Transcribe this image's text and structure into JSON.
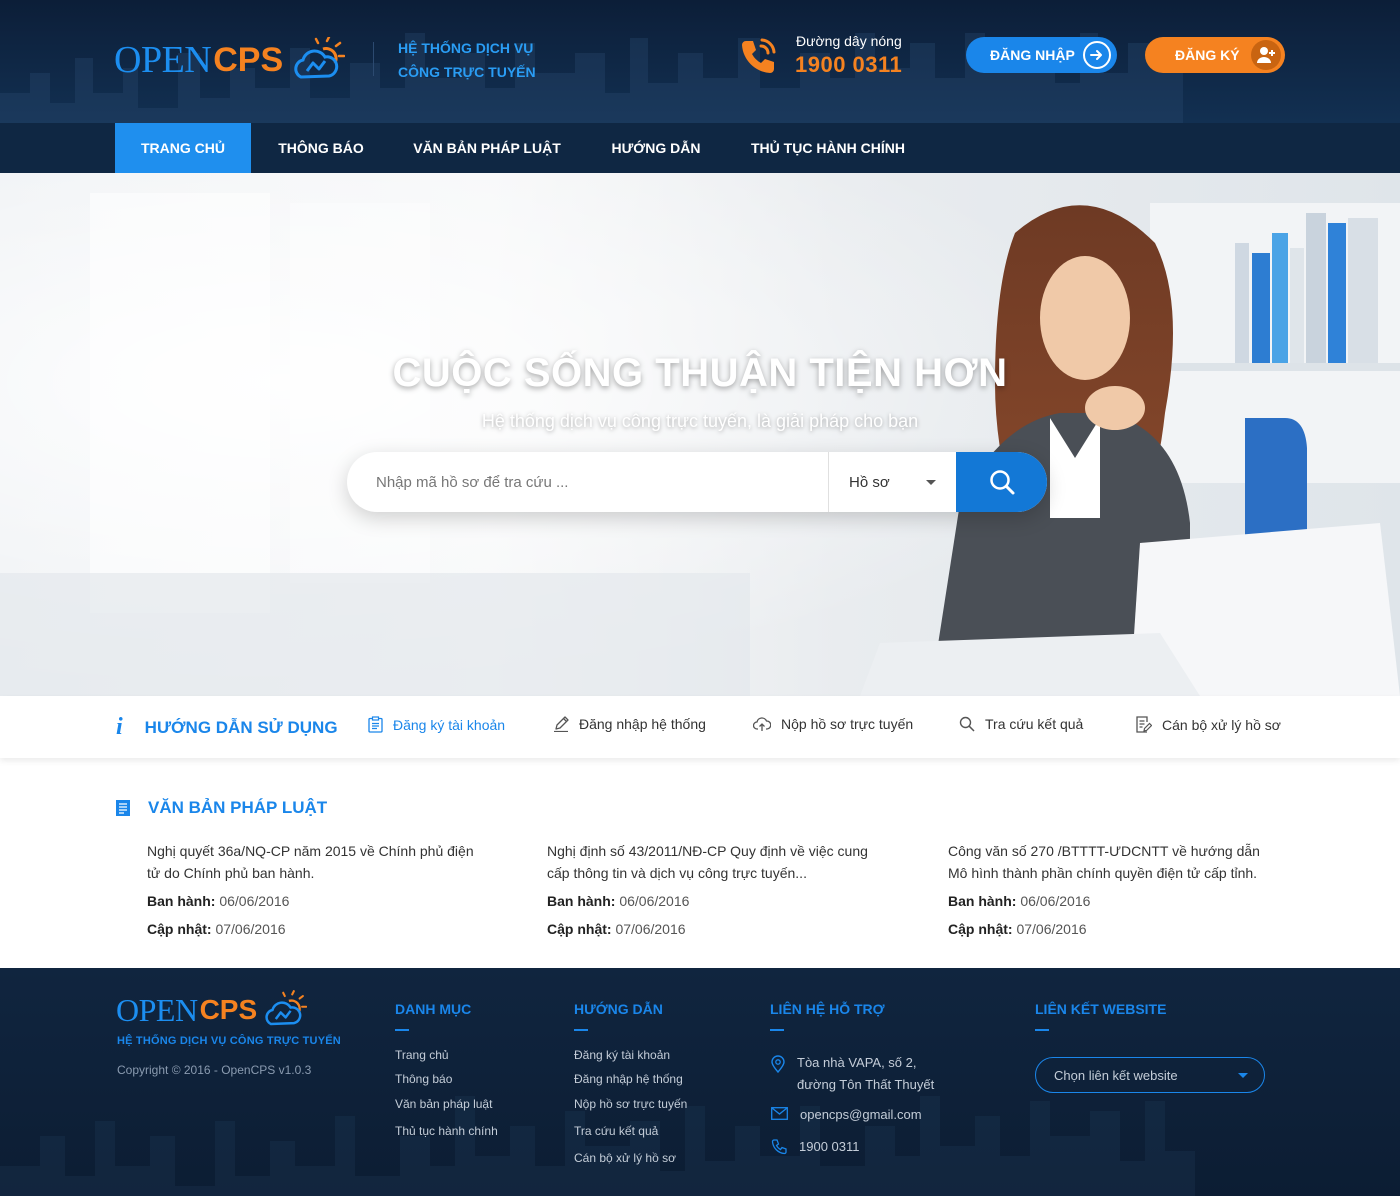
{
  "header": {
    "logo_open": "OPEN",
    "logo_cps": "CPS",
    "tagline_line1": "HỆ THỐNG DỊCH VỤ",
    "tagline_line2": "CÔNG TRỰC TUYẾN",
    "hotline_label": "Đường dây nóng",
    "hotline_number": "1900 0311",
    "login_label": "ĐĂNG NHẬP",
    "register_label": "ĐĂNG KÝ"
  },
  "nav": {
    "items": [
      {
        "label": "TRANG CHỦ",
        "active": true
      },
      {
        "label": "THÔNG BÁO",
        "active": false
      },
      {
        "label": "VĂN BẢN PHÁP LUẬT",
        "active": false
      },
      {
        "label": "HƯỚNG DẪN",
        "active": false
      },
      {
        "label": "THỦ TỤC HÀNH CHÍNH",
        "active": false
      }
    ]
  },
  "hero": {
    "title": "CUỘC SỐNG THUẬN TIỆN HƠN",
    "subtitle": "Hệ thống dịch vụ công trực tuyến, là giải pháp cho bạn",
    "search_placeholder": "Nhập mã hồ sơ để tra cứu ...",
    "search_type_selected": "Hồ sơ"
  },
  "guide": {
    "title": "HƯỚNG DẪN SỬ DỤNG",
    "items": [
      {
        "label": "Đăng ký tài khoản",
        "icon": "clipboard-icon"
      },
      {
        "label": "Đăng nhập hệ thống",
        "icon": "pencil-icon"
      },
      {
        "label": "Nộp hồ sơ trực tuyến",
        "icon": "cloud-upload-icon"
      },
      {
        "label": "Tra cứu kết quả",
        "icon": "search-icon"
      },
      {
        "label": "Cán bộ xử lý hồ sơ",
        "icon": "document-edit-icon"
      }
    ]
  },
  "docs": {
    "title": "VĂN BẢN PHÁP LUẬT",
    "issued_label": "Ban hành:",
    "updated_label": "Cập nhật:",
    "items": [
      {
        "title": "Nghị quyết 36a/NQ-CP năm 2015 về Chính phủ điện tử do Chính phủ ban hành.",
        "issued": "06/06/2016",
        "updated": "07/06/2016"
      },
      {
        "title": "Nghị định số 43/2011/NĐ-CP Quy định về việc cung cấp thông tin và dịch vụ công trực tuyến...",
        "issued": "06/06/2016",
        "updated": "07/06/2016"
      },
      {
        "title": "Công văn số 270 /BTTTT-ƯDCNTT về hướng dẫn Mô hình thành phần chính quyền điện tử cấp tỉnh.",
        "issued": "06/06/2016",
        "updated": "07/06/2016"
      }
    ]
  },
  "footer": {
    "tagline": "HỆ THỐNG DỊCH VỤ CÔNG TRỰC TUYẾN",
    "copyright": "Copyright © 2016 - OpenCPS v1.0.3",
    "danh_muc": {
      "title": "DANH MỤC",
      "links": [
        "Trang chủ",
        "Thông báo",
        "Văn bản pháp luật",
        "Thủ tục hành chính"
      ]
    },
    "huong_dan": {
      "title": "HƯỚNG DẪN",
      "links": [
        "Đăng ký tài khoản",
        "Đăng nhập hệ thống",
        "Nộp hồ sơ trực tuyến",
        "Tra cứu kết quả",
        "Cán bộ xử lý hồ sơ"
      ]
    },
    "lien_he": {
      "title": "LIÊN HỆ HỖ TRỢ",
      "address_line1": "Tòa nhà VAPA, số 2,",
      "address_line2": "đường Tôn Thất Thuyết",
      "email": "opencps@gmail.com",
      "phone": "1900 0311"
    },
    "lien_ket": {
      "title": "LIÊN KẾT WEBSITE",
      "select_placeholder": "Chọn liên kết website"
    }
  },
  "colors": {
    "primary_blue": "#1a86ea",
    "brand_orange": "#f58220",
    "header_navy": "#0c1e38"
  }
}
